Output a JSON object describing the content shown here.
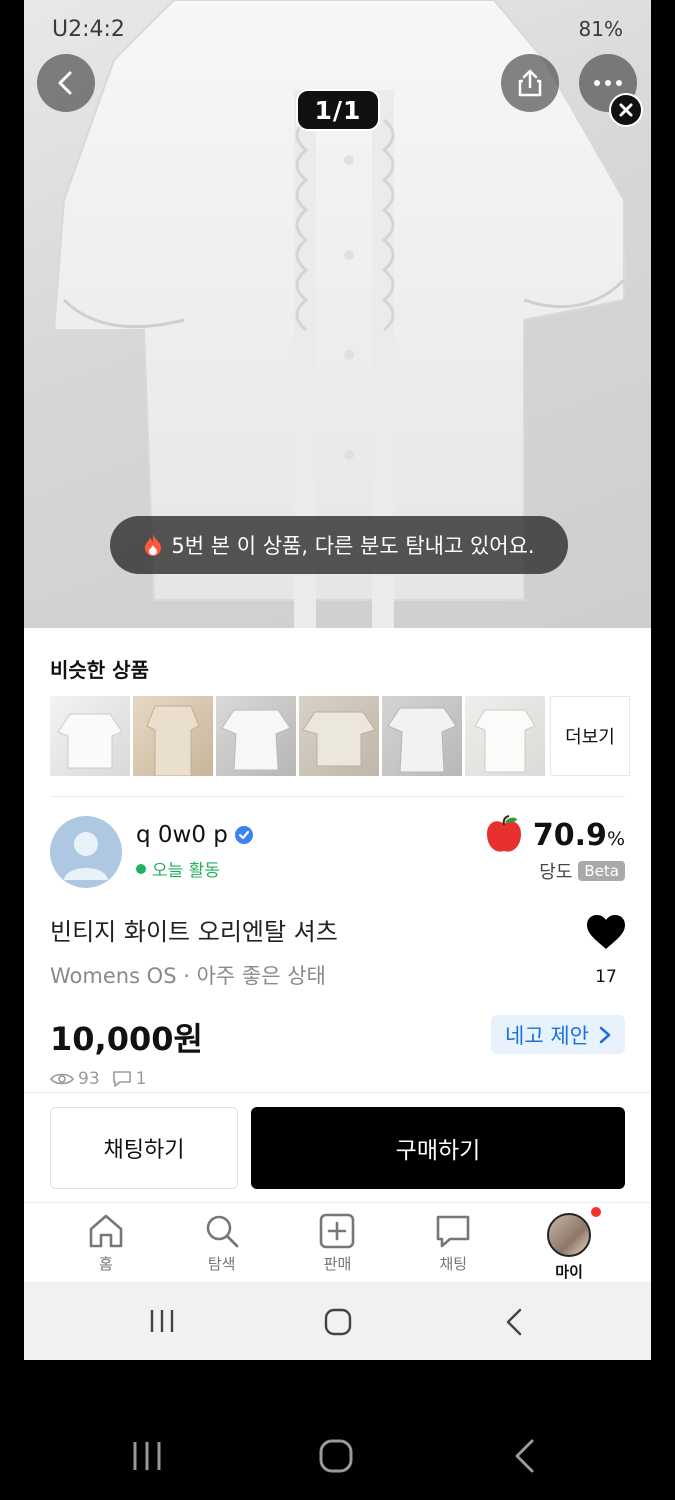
{
  "status_bar": {
    "left": "U2:4:2",
    "right": "81%"
  },
  "image_counter": "1/1",
  "toast": {
    "text": "5번 본 이 상품, 다른 분도 탐내고 있어요."
  },
  "similar": {
    "title": "비슷한 상품",
    "more_label": "더보기"
  },
  "seller": {
    "name": "q 0w0 p",
    "status": "오늘 활동",
    "rating": "70.9",
    "rating_unit": "%",
    "rating_label": "당도",
    "beta": "Beta"
  },
  "product": {
    "title": "빈티지 화이트 오리엔탈 셔츠",
    "subtitle": "Womens OS · 아주 좋은 상태",
    "likes": "17",
    "price": "10,000원",
    "offer_label": "네고 제안",
    "views": "93",
    "comments": "1"
  },
  "actions": {
    "chat": "채팅하기",
    "buy": "구매하기"
  },
  "tabs": [
    {
      "label": "홈",
      "icon": "home-icon"
    },
    {
      "label": "탐색",
      "icon": "search-icon"
    },
    {
      "label": "판매",
      "icon": "plus-square-icon"
    },
    {
      "label": "채팅",
      "icon": "chat-icon"
    },
    {
      "label": "마이",
      "icon": "avatar-icon"
    }
  ],
  "colors": {
    "accent_blue": "#1a73d9",
    "active_green": "#23b15c",
    "badge_red": "#f0322d"
  }
}
